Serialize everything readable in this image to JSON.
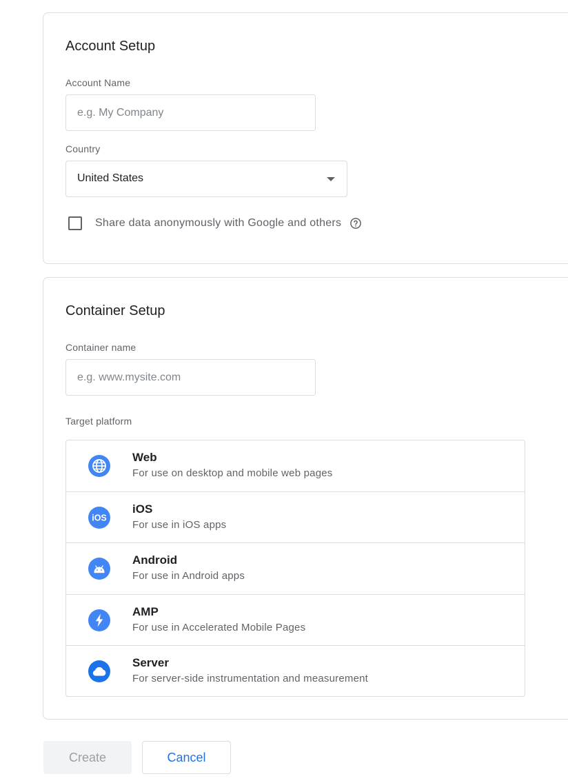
{
  "account_setup": {
    "title": "Account Setup",
    "account_name_label": "Account Name",
    "account_name_placeholder": "e.g. My Company",
    "account_name_value": "",
    "country_label": "Country",
    "country_value": "United States",
    "share_data_label": "Share data anonymously with Google and others",
    "share_data_checked": false,
    "help_icon": "help-circle-icon"
  },
  "container_setup": {
    "title": "Container Setup",
    "container_name_label": "Container name",
    "container_name_placeholder": "e.g. www.mysite.com",
    "container_name_value": "",
    "target_platform_label": "Target platform",
    "platforms": [
      {
        "name": "Web",
        "description": "For use on desktop and mobile web pages",
        "icon": "globe-icon"
      },
      {
        "name": "iOS",
        "description": "For use in iOS apps",
        "icon": "ios-icon"
      },
      {
        "name": "Android",
        "description": "For use in Android apps",
        "icon": "android-icon"
      },
      {
        "name": "AMP",
        "description": "For use in Accelerated Mobile Pages",
        "icon": "lightning-icon"
      },
      {
        "name": "Server",
        "description": "For server-side instrumentation and measurement",
        "icon": "cloud-icon"
      }
    ]
  },
  "actions": {
    "create_label": "Create",
    "create_enabled": false,
    "cancel_label": "Cancel"
  },
  "colors": {
    "accent": "#1a73e8",
    "icon_blue": "#4285f4",
    "border": "#dadce0",
    "secondary_text": "#5f6368"
  }
}
